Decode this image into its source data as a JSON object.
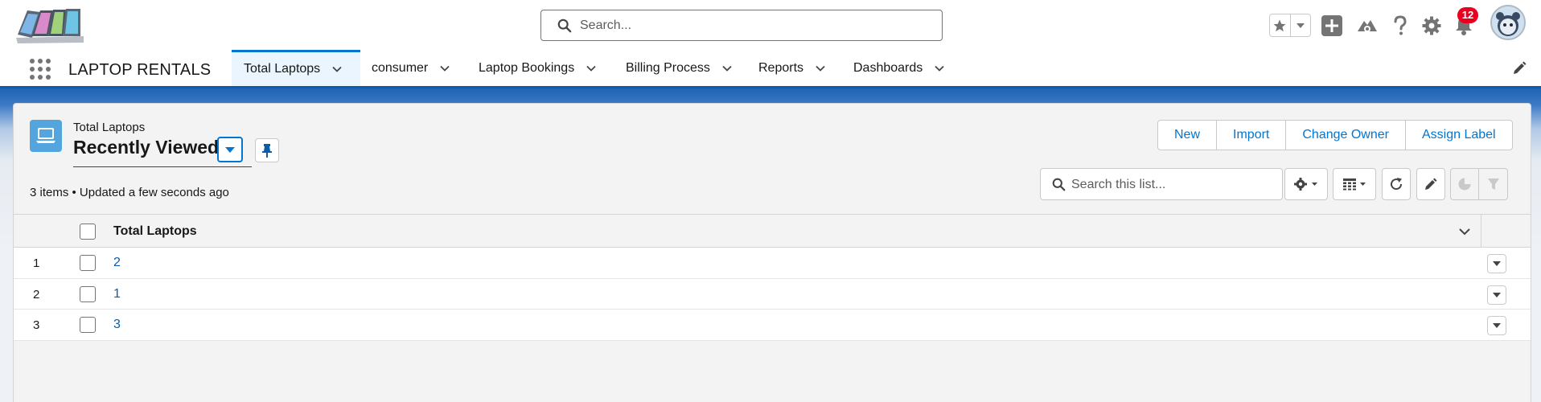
{
  "header": {
    "search_placeholder": "Search...",
    "notification_count": "12",
    "icons": [
      "favorites-star-icon",
      "chevron-down-icon",
      "add-icon",
      "trailhead-icon",
      "help-icon",
      "setup-gear-icon",
      "bell-icon",
      "avatar"
    ]
  },
  "nav": {
    "app_name": "LAPTOP RENTALS",
    "tabs": [
      {
        "label": "Total Laptops",
        "active": true
      },
      {
        "label": "consumer"
      },
      {
        "label": "Laptop Bookings"
      },
      {
        "label": "Billing Process"
      },
      {
        "label": "Reports"
      },
      {
        "label": "Dashboards"
      }
    ]
  },
  "list": {
    "object_label": "Total Laptops",
    "view_name": "Recently Viewed",
    "status": "3 items • Updated a few seconds ago",
    "actions": [
      "New",
      "Import",
      "Change Owner",
      "Assign Label"
    ],
    "search_placeholder": "Search this list...",
    "column_header": "Total Laptops",
    "rows": [
      {
        "num": "1",
        "value": "2"
      },
      {
        "num": "2",
        "value": "1"
      },
      {
        "num": "3",
        "value": "3"
      }
    ]
  },
  "colors": {
    "brand_blue": "#0176d3",
    "nav_active_bg": "#eaf5fe",
    "object_icon": "#54a4dd",
    "badge_red": "#ea001e"
  }
}
